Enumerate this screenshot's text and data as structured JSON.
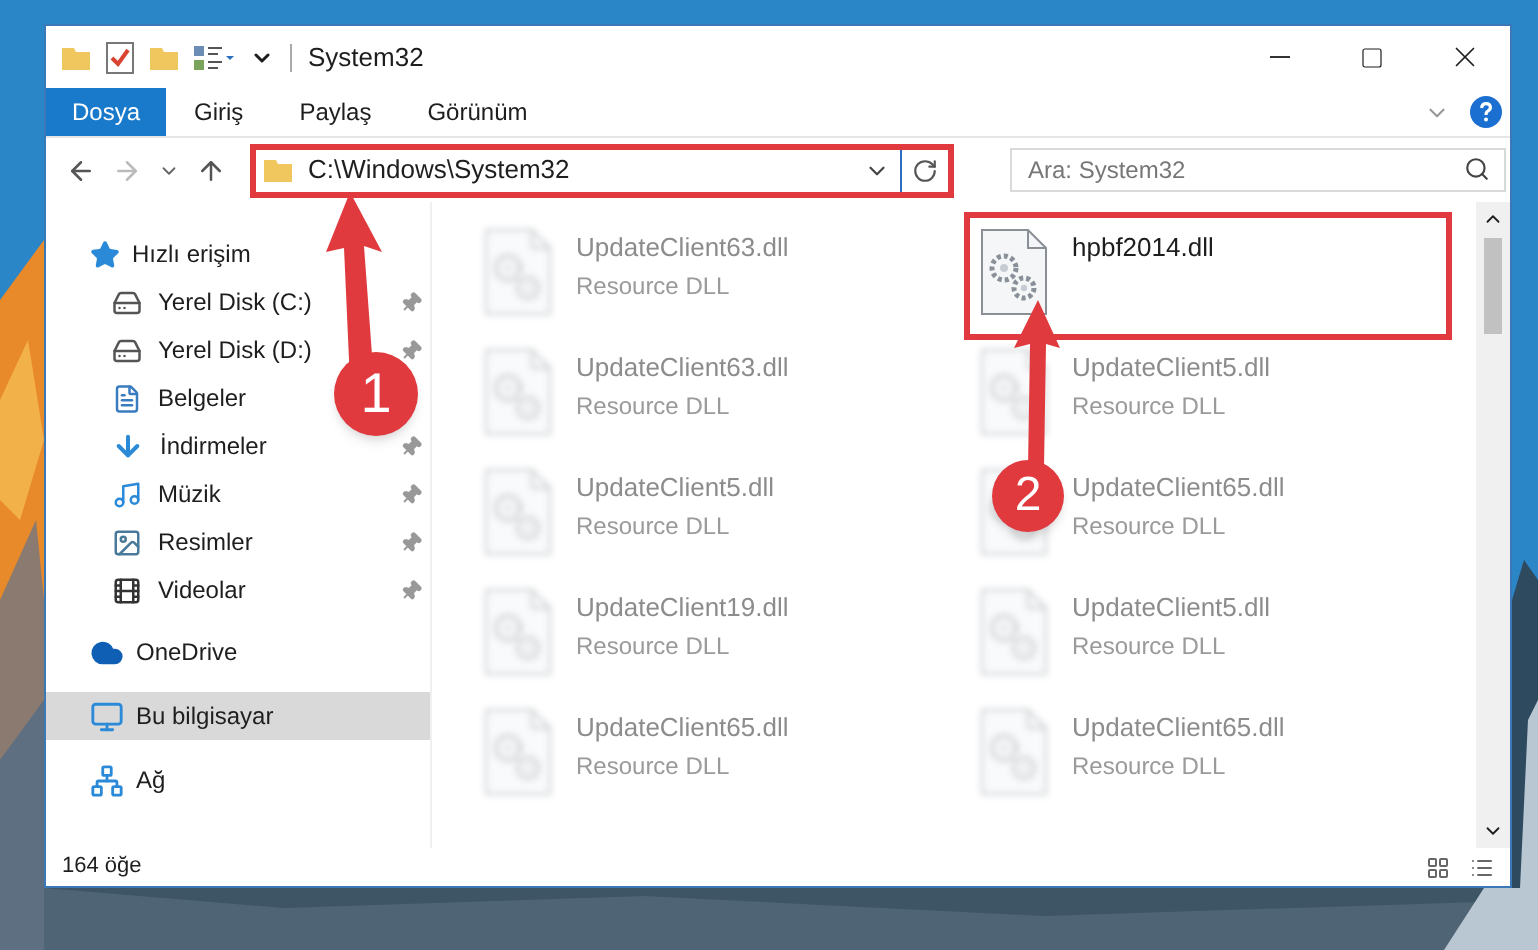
{
  "window": {
    "title": "System32"
  },
  "ribbon_tabs": [
    {
      "label": "Dosya",
      "selected": true
    },
    {
      "label": "Giriş",
      "selected": false
    },
    {
      "label": "Paylaş",
      "selected": false
    },
    {
      "label": "Görünüm",
      "selected": false
    }
  ],
  "address_bar": {
    "path": "C:\\Windows\\System32",
    "highlighted": true
  },
  "search": {
    "placeholder": "Ara: System32"
  },
  "sidebar": {
    "items": [
      {
        "label": "Hızlı erişim",
        "selected": false,
        "children": [
          {
            "label": "Yerel Disk (C:)",
            "pinned": true
          },
          {
            "label": "Yerel Disk (D:)",
            "pinned": true
          },
          {
            "label": "Belgeler",
            "pinned": false
          },
          {
            "label": "İndirmeler",
            "pinned": true
          },
          {
            "label": "Müzik",
            "pinned": true
          },
          {
            "label": "Resimler",
            "pinned": true
          },
          {
            "label": "Videolar",
            "pinned": true
          }
        ]
      },
      {
        "label": "OneDrive",
        "selected": false
      },
      {
        "label": "Bu bilgisayar",
        "selected": true
      },
      {
        "label": "Ağ",
        "selected": false
      }
    ]
  },
  "files": [
    {
      "name": "UpdateClient63.dll",
      "type": "Resource DLL",
      "blurred": true,
      "highlighted": false
    },
    {
      "name": "hpbf2014.dll",
      "blurred": false,
      "highlighted": true
    },
    {
      "name": "UpdateClient63.dll",
      "type": "Resource DLL",
      "blurred": true,
      "highlighted": false
    },
    {
      "name": "UpdateClient5.dll",
      "type": "Resource DLL",
      "blurred": true,
      "highlighted": false
    },
    {
      "name": "UpdateClient5.dll",
      "type": "Resource DLL",
      "blurred": true,
      "highlighted": false
    },
    {
      "name": "UpdateClient65.dll",
      "type": "Resource DLL",
      "blurred": true,
      "highlighted": false
    },
    {
      "name": "UpdateClient19.dll",
      "type": "Resource DLL",
      "blurred": true,
      "highlighted": false
    },
    {
      "name": "UpdateClient5.dll",
      "type": "Resource DLL",
      "blurred": true,
      "highlighted": false
    },
    {
      "name": "UpdateClient65.dll",
      "type": "Resource DLL",
      "blurred": true,
      "highlighted": false
    },
    {
      "name": "UpdateClient65.dll",
      "type": "Resource DLL",
      "blurred": true,
      "highlighted": false
    }
  ],
  "annotations": [
    {
      "label": "1"
    },
    {
      "label": "2"
    }
  ],
  "status_bar": {
    "item_count": "164 öğe"
  }
}
